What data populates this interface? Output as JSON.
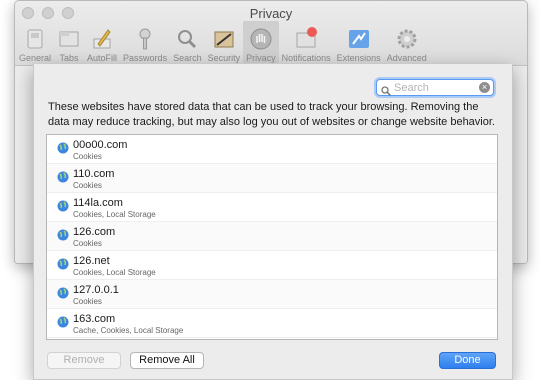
{
  "window": {
    "title": "Privacy"
  },
  "toolbar": {
    "items": [
      {
        "label": "General",
        "icon": "general-icon"
      },
      {
        "label": "Tabs",
        "icon": "tabs-icon"
      },
      {
        "label": "AutoFill",
        "icon": "autofill-icon"
      },
      {
        "label": "Passwords",
        "icon": "key-icon"
      },
      {
        "label": "Search",
        "icon": "magnifier-icon"
      },
      {
        "label": "Security",
        "icon": "lock-icon"
      },
      {
        "label": "Privacy",
        "icon": "hand-icon",
        "active": true
      },
      {
        "label": "Notifications",
        "icon": "notifications-icon"
      },
      {
        "label": "Extensions",
        "icon": "extensions-icon"
      },
      {
        "label": "Advanced",
        "icon": "gear-icon"
      }
    ]
  },
  "sheet": {
    "search": {
      "placeholder": "Search",
      "value": ""
    },
    "description": "These websites have stored data that can be used to track your browsing. Removing the data may reduce tracking, but may also log you out of websites or change website behavior.",
    "sites": [
      {
        "name": "00o00.com",
        "data": "Cookies"
      },
      {
        "name": "110.com",
        "data": "Cookies"
      },
      {
        "name": "114la.com",
        "data": "Cookies, Local Storage"
      },
      {
        "name": "126.com",
        "data": "Cookies"
      },
      {
        "name": "126.net",
        "data": "Cookies, Local Storage"
      },
      {
        "name": "127.0.0.1",
        "data": "Cookies"
      },
      {
        "name": "163.com",
        "data": "Cache, Cookies, Local Storage"
      }
    ],
    "buttons": {
      "remove": "Remove",
      "remove_all": "Remove All",
      "done": "Done"
    }
  },
  "colors": {
    "accent": "#2d7ff0",
    "window_bg": "#ececec"
  }
}
